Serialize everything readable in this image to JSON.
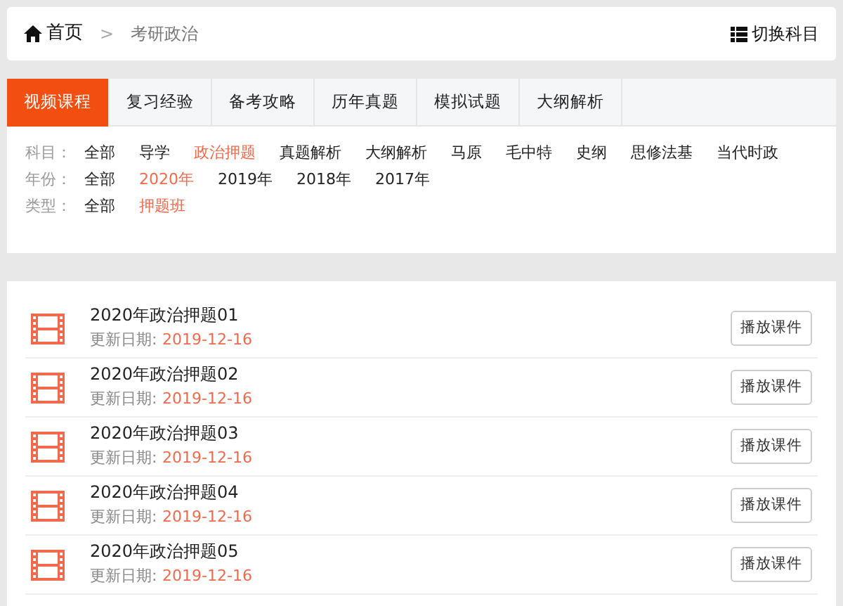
{
  "breadcrumb": {
    "home": "首页",
    "separator": ">",
    "current": "考研政治"
  },
  "switch_subject": "切换科目",
  "tabs": [
    {
      "label": "视频课程",
      "selected": true
    },
    {
      "label": "复习经验",
      "selected": false
    },
    {
      "label": "备考攻略",
      "selected": false
    },
    {
      "label": "历年真题",
      "selected": false
    },
    {
      "label": "模拟试题",
      "selected": false
    },
    {
      "label": "大纲解析",
      "selected": false
    }
  ],
  "filters": [
    {
      "label": "科目：",
      "options": [
        {
          "label": "全部",
          "selected": false
        },
        {
          "label": "导学",
          "selected": false
        },
        {
          "label": "政治押题",
          "selected": true
        },
        {
          "label": "真题解析",
          "selected": false
        },
        {
          "label": "大纲解析",
          "selected": false
        },
        {
          "label": "马原",
          "selected": false
        },
        {
          "label": "毛中特",
          "selected": false
        },
        {
          "label": "史纲",
          "selected": false
        },
        {
          "label": "思修法基",
          "selected": false
        },
        {
          "label": "当代时政",
          "selected": false
        }
      ]
    },
    {
      "label": "年份：",
      "options": [
        {
          "label": "全部",
          "selected": false
        },
        {
          "label": "2020年",
          "selected": true
        },
        {
          "label": "2019年",
          "selected": false
        },
        {
          "label": "2018年",
          "selected": false
        },
        {
          "label": "2017年",
          "selected": false
        }
      ]
    },
    {
      "label": "类型：",
      "options": [
        {
          "label": "全部",
          "selected": false
        },
        {
          "label": "押题班",
          "selected": true
        }
      ]
    }
  ],
  "courses": [
    {
      "title": "2020年政治押题01",
      "date_label": "更新日期:",
      "date": "2019-12-16",
      "button": "播放课件"
    },
    {
      "title": "2020年政治押题02",
      "date_label": "更新日期:",
      "date": "2019-12-16",
      "button": "播放课件"
    },
    {
      "title": "2020年政治押题03",
      "date_label": "更新日期:",
      "date": "2019-12-16",
      "button": "播放课件"
    },
    {
      "title": "2020年政治押题04",
      "date_label": "更新日期:",
      "date": "2019-12-16",
      "button": "播放课件"
    },
    {
      "title": "2020年政治押题05",
      "date_label": "更新日期:",
      "date": "2019-12-16",
      "button": "播放课件"
    }
  ]
}
